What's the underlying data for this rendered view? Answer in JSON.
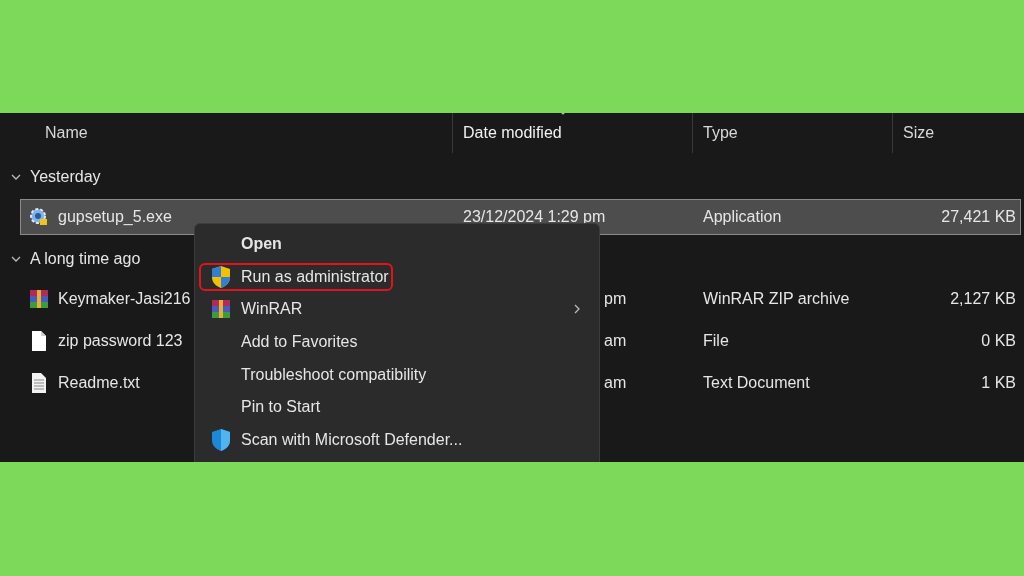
{
  "columns": [
    {
      "label": "Name",
      "sorted": false
    },
    {
      "label": "Date modified",
      "sorted": true
    },
    {
      "label": "Type",
      "sorted": false
    },
    {
      "label": "Size",
      "sorted": false
    }
  ],
  "groups": [
    {
      "label": "Yesterday",
      "files": [
        {
          "name": "gupsetup_5.exe",
          "kind": "setup",
          "date": "23/12/2024 1:29 pm",
          "type": "Application",
          "size": "27,421 KB",
          "selected": true
        }
      ]
    },
    {
      "label": "A long time ago",
      "files": [
        {
          "name": "Keymaker-Jasi216",
          "kind": "archive",
          "date": "pm",
          "type": "WinRAR ZIP archive",
          "size": "2,127 KB",
          "selected": false
        },
        {
          "name": "zip password 123",
          "kind": "blank",
          "date": "am",
          "type": "File",
          "size": "0 KB",
          "selected": false
        },
        {
          "name": "Readme.txt",
          "kind": "text",
          "date": "am",
          "type": "Text Document",
          "size": "1 KB",
          "selected": false
        }
      ]
    }
  ],
  "context_menu": {
    "items": [
      {
        "label": "Open",
        "kind": "plain",
        "bold": true,
        "highlighted": false,
        "submenu": false
      },
      {
        "label": "Run as administrator",
        "kind": "uac",
        "bold": false,
        "highlighted": true,
        "submenu": false
      },
      {
        "label": "WinRAR",
        "kind": "archive",
        "bold": false,
        "highlighted": false,
        "submenu": true
      },
      {
        "label": "Add to Favorites",
        "kind": "plain",
        "bold": false,
        "highlighted": false,
        "submenu": false
      },
      {
        "label": "Troubleshoot compatibility",
        "kind": "plain",
        "bold": false,
        "highlighted": false,
        "submenu": false
      },
      {
        "label": "Pin to Start",
        "kind": "plain",
        "bold": false,
        "highlighted": false,
        "submenu": false
      },
      {
        "label": "Scan with Microsoft Defender...",
        "kind": "defender",
        "bold": false,
        "highlighted": false,
        "submenu": false
      }
    ]
  }
}
